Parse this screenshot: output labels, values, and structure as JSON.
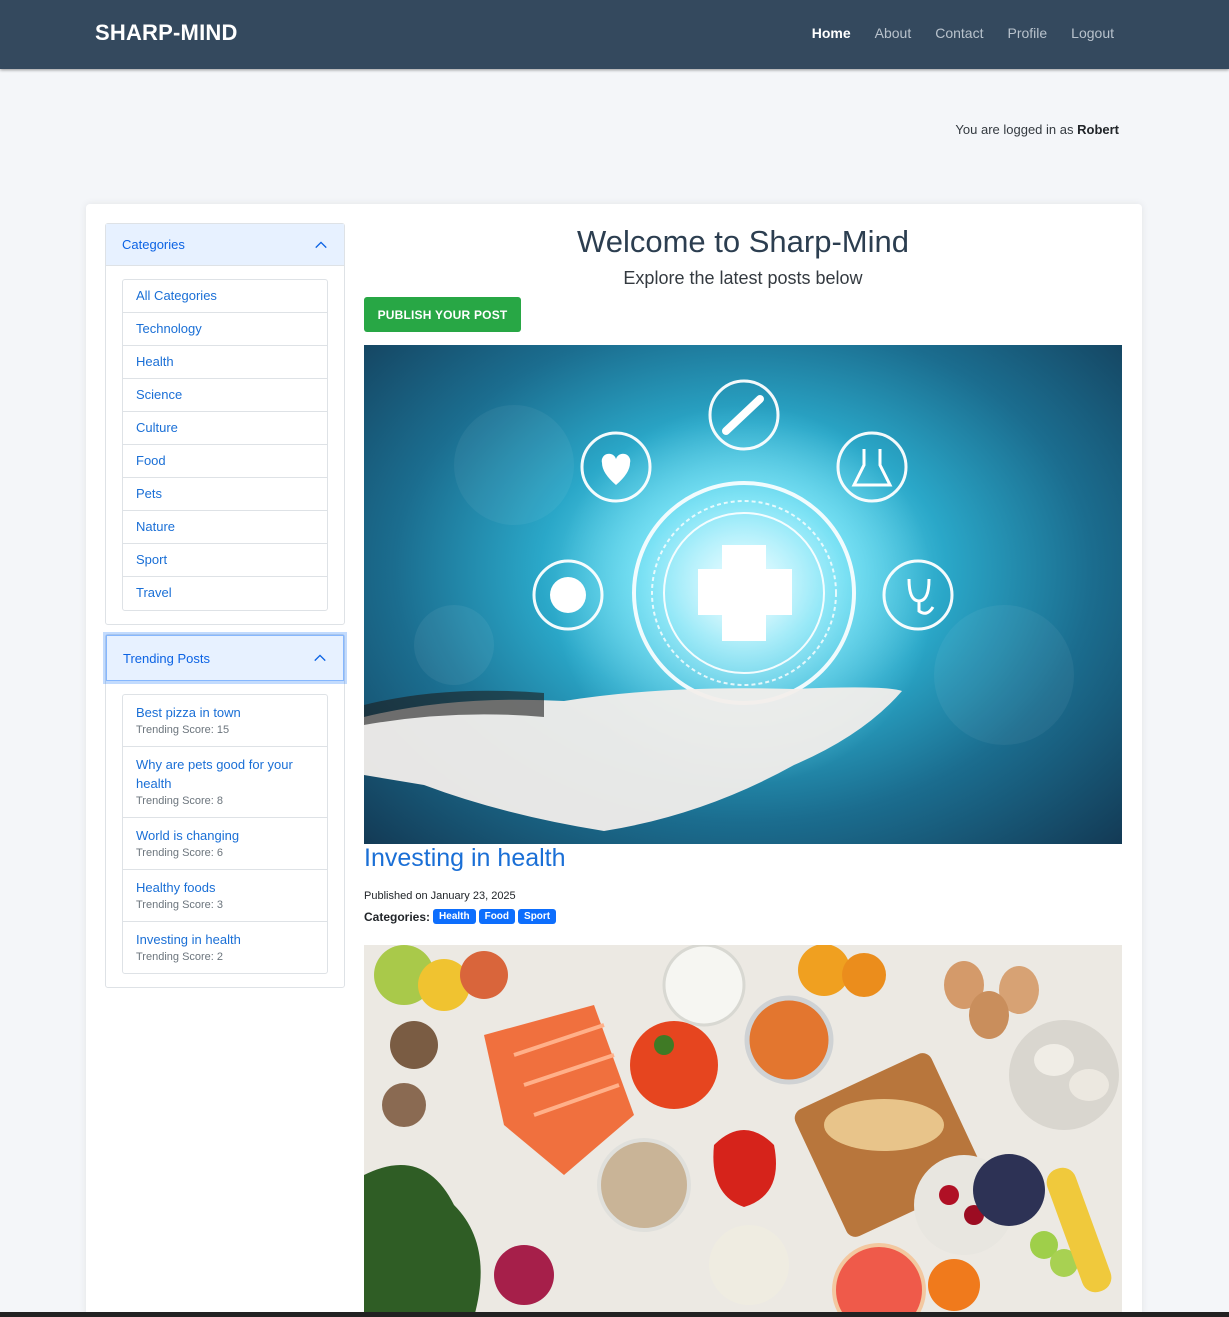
{
  "navbar": {
    "brand": "SHARP-MIND",
    "links": [
      {
        "label": "Home",
        "active": true
      },
      {
        "label": "About",
        "active": false
      },
      {
        "label": "Contact",
        "active": false
      },
      {
        "label": "Profile",
        "active": false
      },
      {
        "label": "Logout",
        "active": false
      }
    ]
  },
  "login_status": {
    "prefix": "You are logged in as",
    "username": "Robert"
  },
  "sidebar": {
    "categories": {
      "header": "Categories",
      "items": [
        "All Categories",
        "Technology",
        "Health",
        "Science",
        "Culture",
        "Food",
        "Pets",
        "Nature",
        "Sport",
        "Travel"
      ]
    },
    "trending": {
      "header": "Trending Posts",
      "score_label": "Trending Score:",
      "items": [
        {
          "title": "Best pizza in town",
          "score": "Trending Score: 15"
        },
        {
          "title": "Why are pets good for your health",
          "score": "Trending Score: 8"
        },
        {
          "title": "World is changing",
          "score": "Trending Score: 6"
        },
        {
          "title": "Healthy foods",
          "score": "Trending Score: 3"
        },
        {
          "title": "Investing in health",
          "score": "Trending Score: 2"
        }
      ]
    }
  },
  "main": {
    "title": "Welcome to Sharp-Mind",
    "subtitle": "Explore the latest posts below",
    "publish_button": "PUBLISH YOUR POST",
    "posts": [
      {
        "title": "Investing in health",
        "date": "Published on January 23, 2025",
        "categories_label": "Categories:",
        "categories": [
          "Health",
          "Food",
          "Sport"
        ]
      }
    ]
  },
  "colors": {
    "navbar": "#34495e",
    "link": "#1a6fd6",
    "publish": "#28a745",
    "badge": "#0d6efd",
    "accordion_header": "#e7f1ff"
  }
}
